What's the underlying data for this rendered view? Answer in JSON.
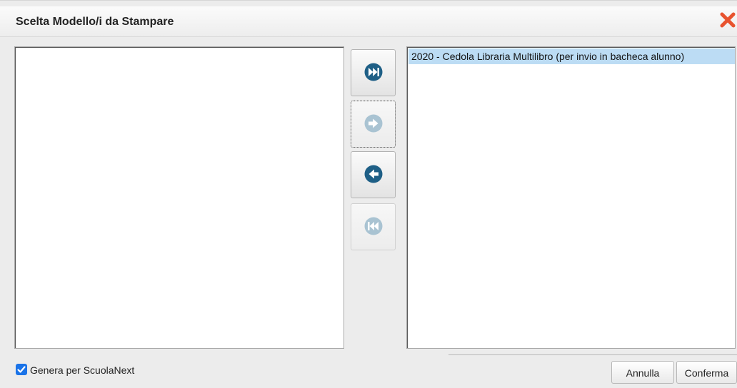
{
  "dialog": {
    "title": "Scelta Modello/i da Stampare",
    "close_icon": "close-icon"
  },
  "available_list": {
    "items": []
  },
  "selected_list": {
    "items": [
      {
        "label": "2020 - Cedola Libraria Multilibro (per invio in bacheca alunno)",
        "selected": true
      }
    ]
  },
  "transfer_buttons": [
    {
      "name": "move-all-right-button",
      "icon": "fast-forward-icon",
      "enabled": true
    },
    {
      "name": "move-right-button",
      "icon": "arrow-right-icon",
      "enabled": false
    },
    {
      "name": "move-left-button",
      "icon": "arrow-left-icon",
      "enabled": true
    },
    {
      "name": "move-all-left-button",
      "icon": "fast-rewind-icon",
      "enabled": false
    }
  ],
  "options": {
    "genera_scuolanext_label": "Genera per ScuolaNext",
    "genera_scuolanext_checked": true
  },
  "actions": {
    "cancel_label": "Annulla",
    "confirm_label": "Conferma"
  },
  "colors": {
    "icon_active": "#1e5f86",
    "icon_disabled": "#a9c3d2",
    "selection": "#bcdcf4",
    "close": "#e8532f",
    "checkbox": "#1a73e8"
  }
}
